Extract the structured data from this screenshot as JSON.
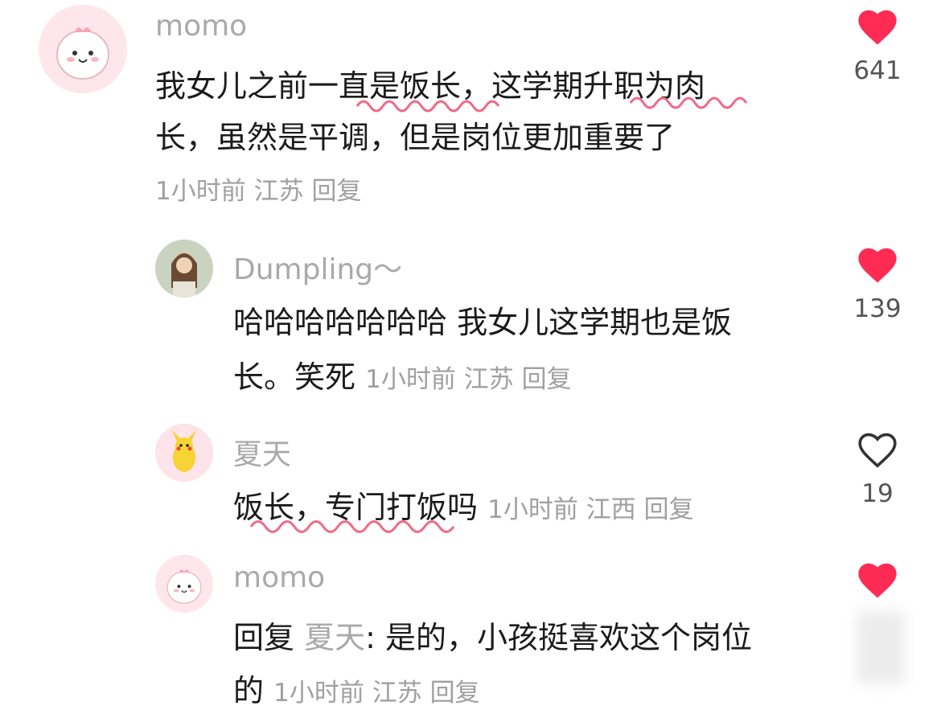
{
  "comments": [
    {
      "user": "momo",
      "line1": "我女儿之前一直是饭长，这学期升职为肉",
      "line2": "长，虽然是平调，但是岗位更加重要了",
      "time": "1小时前",
      "location": "江苏",
      "reply_label": "回复",
      "likes": "641",
      "liked": true
    },
    {
      "user": "Dumpling～",
      "line1": "哈哈哈哈哈哈哈 我女儿这学期也是饭",
      "line2": "长。笑死",
      "time": "1小时前",
      "location": "江苏",
      "reply_label": "回复",
      "likes": "139",
      "liked": true
    },
    {
      "user": "夏天",
      "line1": "饭长，专门打饭吗",
      "time": "1小时前",
      "location": "江西",
      "reply_label": "回复",
      "likes": "19",
      "liked": false
    },
    {
      "user": "momo",
      "reply_prefix": "回复",
      "reply_to": "夏天",
      "line1_rest": ": 是的，小孩挺喜欢这个岗位",
      "line2": "的",
      "time": "1小时前",
      "location": "江苏",
      "reply_label": "回复",
      "liked": true
    }
  ],
  "colors": {
    "heart_liked": "#fe2c55",
    "heart_outline": "#333333",
    "squiggle": "#f06b86"
  },
  "icons": [
    "heart-filled-icon",
    "heart-outline-icon"
  ]
}
